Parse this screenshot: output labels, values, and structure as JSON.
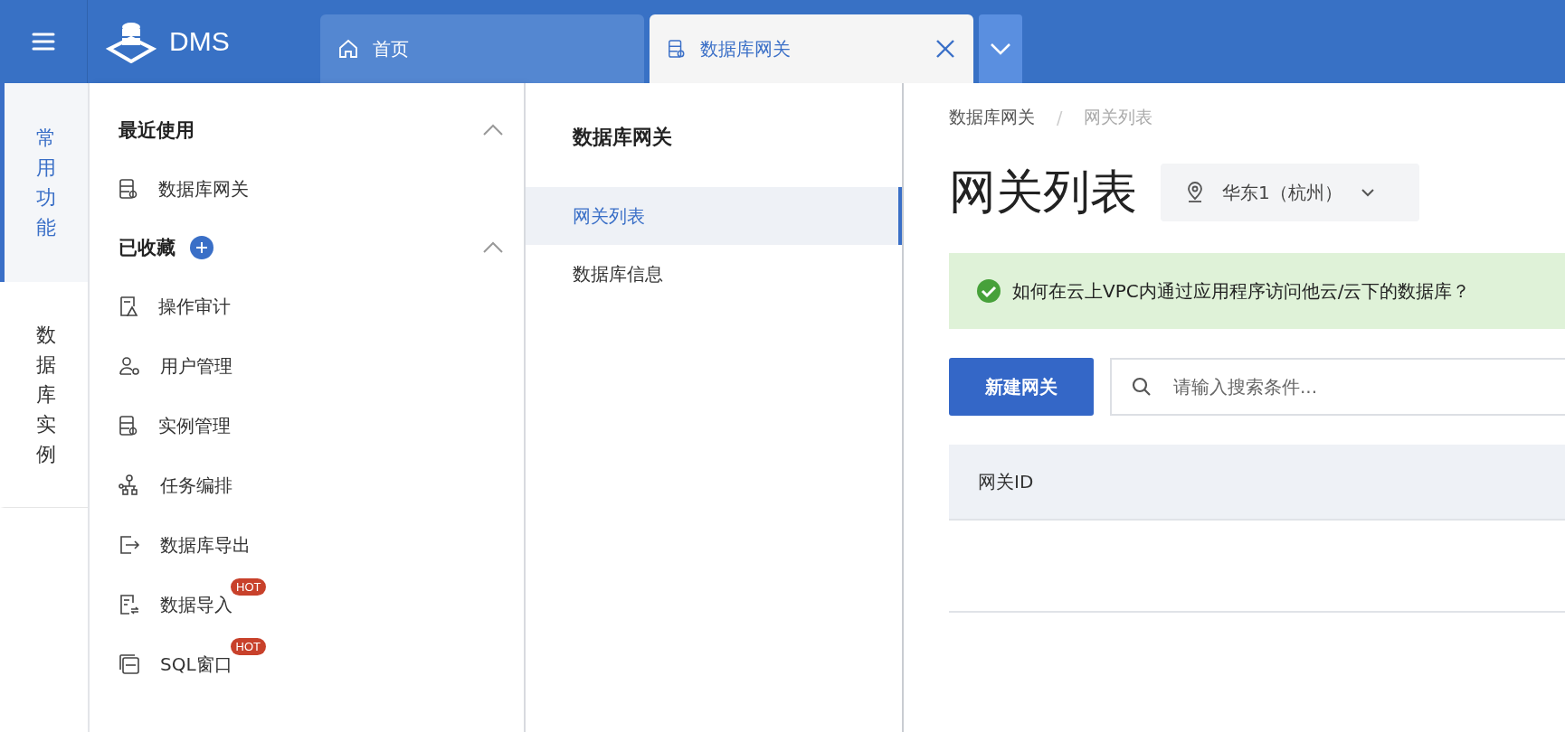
{
  "header": {
    "logo_text": "DMS"
  },
  "tabs": [
    {
      "label": "首页",
      "selected": false,
      "closable": false
    },
    {
      "label": "数据库网关",
      "selected": true,
      "closable": true
    }
  ],
  "side_tabs": [
    {
      "label": "常用功能",
      "selected": true
    },
    {
      "label": "数据库实例",
      "selected": false
    }
  ],
  "menu": {
    "sections": [
      {
        "title": "最近使用",
        "expanded": true,
        "addable": false,
        "items": [
          {
            "label": "数据库网关"
          }
        ]
      },
      {
        "title": "已收藏",
        "expanded": true,
        "addable": true,
        "items": [
          {
            "label": "操作审计"
          },
          {
            "label": "用户管理"
          },
          {
            "label": "实例管理"
          },
          {
            "label": "任务编排"
          },
          {
            "label": "数据库导出"
          },
          {
            "label": "数据导入",
            "badge": "HOT"
          },
          {
            "label": "SQL窗口",
            "badge": "HOT"
          }
        ]
      }
    ]
  },
  "nav": {
    "title": "数据库网关",
    "items": [
      {
        "label": "网关列表",
        "selected": true
      },
      {
        "label": "数据库信息",
        "selected": false
      }
    ]
  },
  "breadcrumb": [
    "数据库网关",
    "网关列表"
  ],
  "breadcrumb_separator": "/",
  "page_title": "网关列表",
  "region": "华东1（杭州）",
  "alert": "如何在云上VPC内通过应用程序访问他云/云下的数据库？",
  "new_button": "新建网关",
  "search": {
    "placeholder": "请输入搜索条件..."
  },
  "table": {
    "columns": [
      "网关ID"
    ]
  }
}
